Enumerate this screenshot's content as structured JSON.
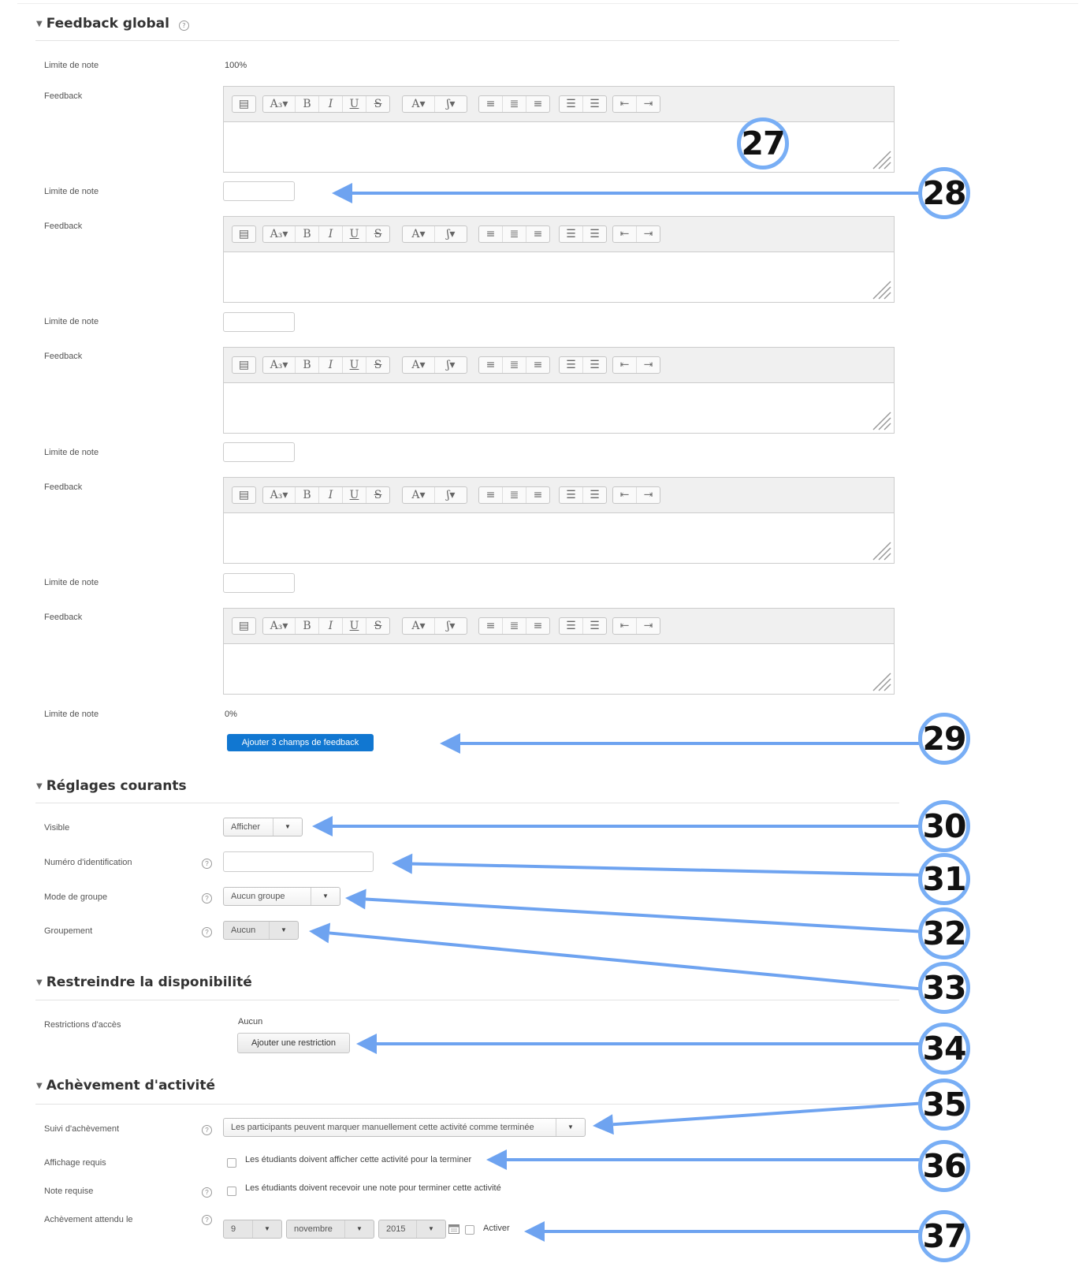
{
  "feedback_global": {
    "title": "Feedback global",
    "help_icon": "?",
    "label_limit": "Limite de note",
    "label_feedback": "Feedback",
    "first_limit_value": "100%",
    "last_limit_value": "0%",
    "add_fields_button": "Ajouter 3 champs de feedback",
    "toolbar": {
      "format": "▤",
      "font_size": "A₃▾",
      "bold": "B",
      "italic": "I",
      "underline": "U",
      "strike": "S",
      "text_color": "A▾",
      "highlight": "ʃ▾",
      "align_left": "≡",
      "align_center": "≣",
      "align_right": "≡",
      "bullets": "☰",
      "numbers": "☰",
      "outdent": "⇤",
      "indent": "⇥"
    }
  },
  "reglages": {
    "title": "Réglages courants",
    "visible_label": "Visible",
    "visible_value": "Afficher",
    "id_label": "Numéro d'identification",
    "group_mode_label": "Mode de groupe",
    "group_mode_value": "Aucun groupe",
    "grouping_label": "Groupement",
    "grouping_value": "Aucun"
  },
  "restreindre": {
    "title": "Restreindre la disponibilité",
    "access_label": "Restrictions d'accès",
    "access_value": "Aucun",
    "add_restriction_button": "Ajouter une restriction"
  },
  "achevement": {
    "title": "Achèvement d'activité",
    "tracking_label": "Suivi d'achèvement",
    "tracking_value": "Les participants peuvent marquer manuellement cette activité comme terminée",
    "view_label": "Affichage requis",
    "view_text": "Les étudiants doivent afficher cette activité pour la terminer",
    "grade_label": "Note requise",
    "grade_text": "Les étudiants doivent recevoir une note pour terminer cette activité",
    "expected_label": "Achèvement attendu le",
    "day": "9",
    "month": "novembre",
    "year": "2015",
    "enable_label": "Activer"
  },
  "callouts": [
    "27",
    "28",
    "29",
    "30",
    "31",
    "32",
    "33",
    "34",
    "35",
    "36",
    "37"
  ],
  "colors": {
    "arrow": "#6ea3f0",
    "primary_button": "#1177d1"
  }
}
